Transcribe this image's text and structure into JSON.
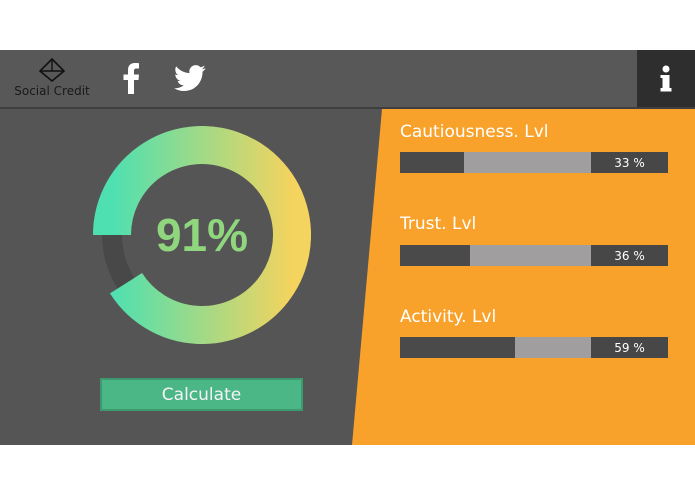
{
  "header": {
    "brand": "Social Credit",
    "facebook_icon": "facebook-icon",
    "twitter_icon": "twitter-icon",
    "info_icon": "info-icon"
  },
  "score": {
    "value": "91%",
    "percent": 91,
    "gradient_start": "#4ee0b0",
    "gradient_end": "#f4d35e"
  },
  "actions": {
    "calculate_label": "Calculate"
  },
  "stats": [
    {
      "label": "Cautiousness. Lvl",
      "value": "33 %",
      "fill": 0.24
    },
    {
      "label": "Trust. Lvl",
      "value": "36 %",
      "fill": 0.26
    },
    {
      "label": "Activity. Lvl",
      "value": "59 %",
      "fill": 0.43
    }
  ],
  "colors": {
    "background": "#555555",
    "panel": "#f9a22b",
    "button": "#4bb786"
  }
}
